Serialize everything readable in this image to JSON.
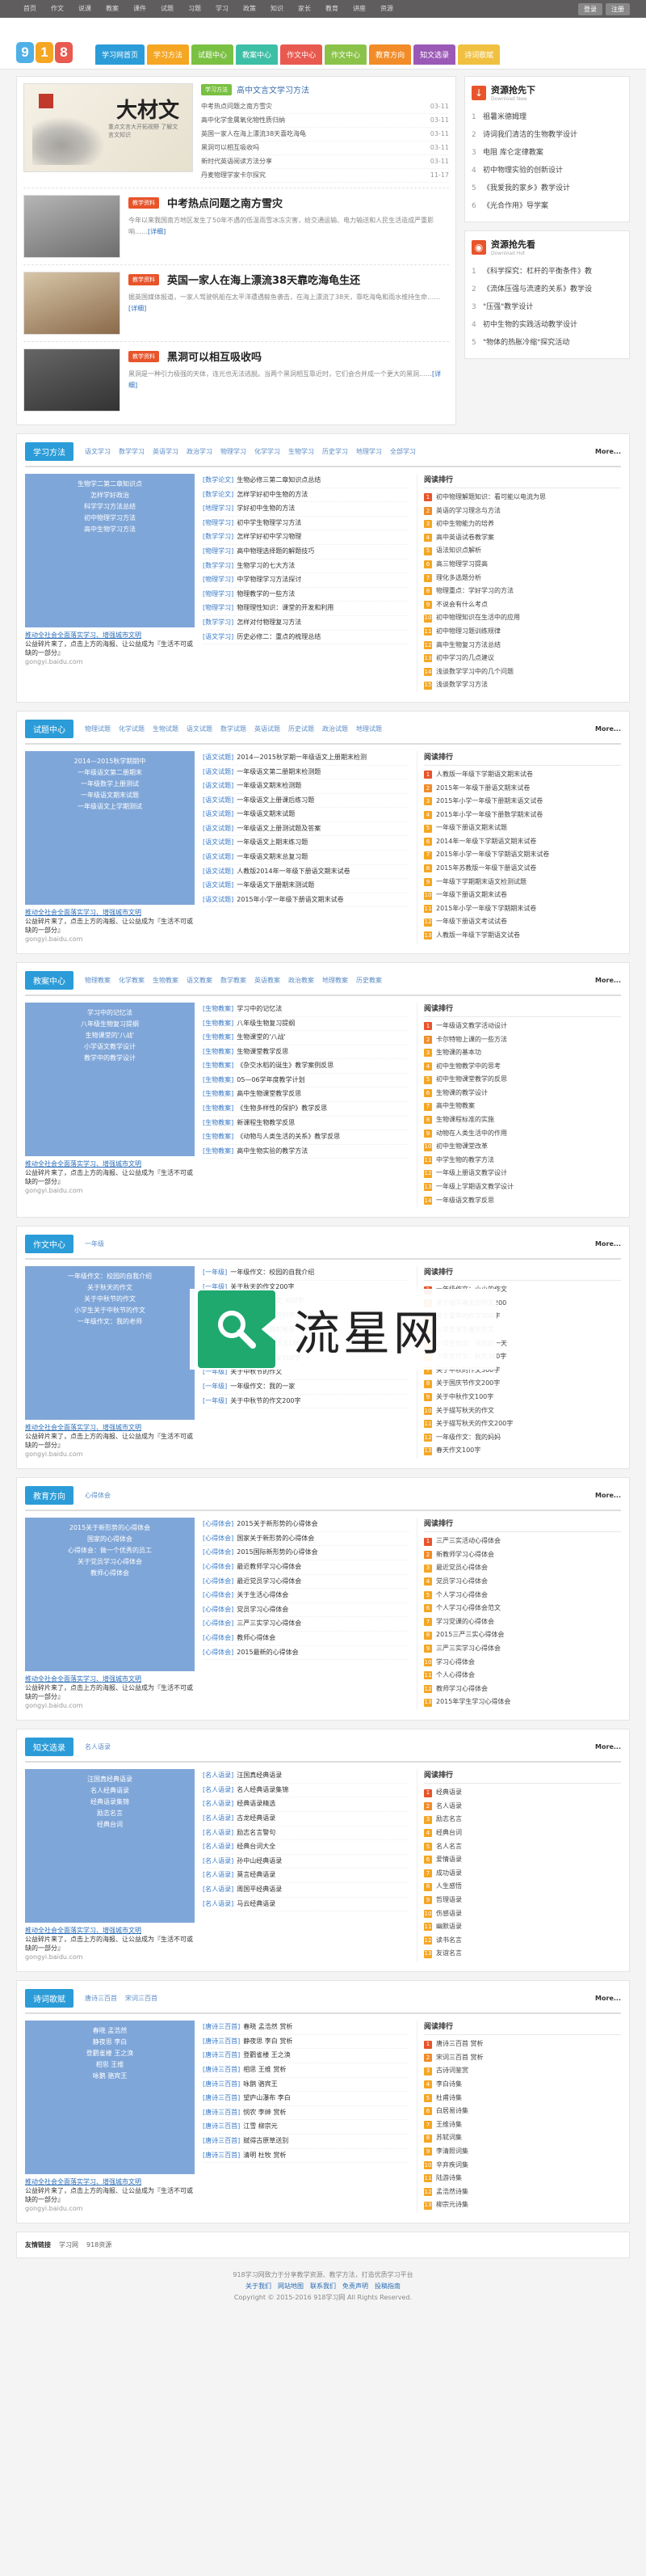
{
  "topbar": {
    "nav": [
      "首页",
      "作文",
      "说课",
      "教案",
      "课件",
      "试题",
      "习题",
      "学习",
      "政策",
      "知识",
      "家长",
      "教育",
      "讲座",
      "资源"
    ],
    "login": "登录",
    "register": "注册"
  },
  "logo": {
    "chars": [
      "9",
      "1",
      "8"
    ],
    "colors": [
      "#4fb0e8",
      "#f5a623",
      "#e85a4f"
    ]
  },
  "mainnav": [
    {
      "label": "学习网首页",
      "color": "#2b9cd8"
    },
    {
      "label": "学习方法",
      "color": "#f5a623"
    },
    {
      "label": "试题中心",
      "color": "#7ac143"
    },
    {
      "label": "教案中心",
      "color": "#3dbfa6"
    },
    {
      "label": "作文中心",
      "color": "#e85a4f"
    },
    {
      "label": "作文中心",
      "color": "#8bc34a"
    },
    {
      "label": "教育方向",
      "color": "#f28c28"
    },
    {
      "label": "知文选录",
      "color": "#9b59b6"
    },
    {
      "label": "诗词歌赋",
      "color": "#f0c040"
    }
  ],
  "hero": {
    "tag": "学习方法",
    "title": "高中文言文学习方法",
    "image_title": "大材文",
    "image_sub": "重点文言大开拓视野 了解文言文知识",
    "rows": [
      {
        "t": "中考热点问题之南方雪灾",
        "d": "03-11"
      },
      {
        "t": "高中化学金属氧化物性质归纳",
        "d": "03-11"
      },
      {
        "t": "英国一家人在海上漂流38天喜吃海龟",
        "d": "03-11"
      },
      {
        "t": "黑洞可以相互吸收吗",
        "d": "03-11"
      },
      {
        "t": "新时代英语阅读方法分享",
        "d": "03-11"
      },
      {
        "t": "丹麦物理学家卡尔探究",
        "d": "11-17"
      }
    ]
  },
  "news": [
    {
      "tag": "教学资料",
      "title": "中考热点问题之南方雪灾",
      "desc": "今年以来我国南方地区发生了50年不遇的低温雨雪冰冻灾害，给交通运输、电力输送和人民生活造成严重影响……",
      "more": "[详细]"
    },
    {
      "tag": "教学资料",
      "title": "英国一家人在海上漂流38天靠吃海龟生还",
      "desc": "据英国媒体报道，一家人驾驶帆船在太平洋遭遇鲸鱼袭击，在海上漂流了38天，靠吃海龟和雨水维持生命……",
      "more": "[详细]"
    },
    {
      "tag": "教学资料",
      "title": "黑洞可以相互吸收吗",
      "desc": "黑洞是一种引力极强的天体，连光也无法逃脱。当两个黑洞相互靠近时，它们会合并成一个更大的黑洞……",
      "more": "[详细]"
    }
  ],
  "resources_down": {
    "title": "资源抢先下",
    "subtitle": "Download New",
    "items": [
      "祖暑米德姆理",
      "诗词我们清洁的生物教学设计",
      "电阻  库仑定律教案",
      "初中物理实验的创新设计",
      "《我爱我的家乡》教学设计",
      "《光合作用》导学案"
    ]
  },
  "resources_look": {
    "title": "资源抢先看",
    "subtitle": "Download Hot",
    "items": [
      "《科学探究：杠杆的平衡条件》教",
      "《流体压强与流速的关系》教学设",
      "\"压强\"教学设计",
      "初中生物的实践活动教学设计",
      "\"物体的热胀冷缩\"探究活动"
    ]
  },
  "ad": {
    "title_line": "推动全社会全面落实学习、增强城市文明",
    "desc": "公益碎片来了，点击上方的海报、让公益成为『生活不可或缺的一部分』",
    "url": "gongyi.baidu.com"
  },
  "sections": [
    {
      "title": "学习方法",
      "color": "#2b9cd8",
      "tabs": [
        "语文学习",
        "数学学习",
        "英语学习",
        "政治学习",
        "物理学习",
        "化学学习",
        "生物学习",
        "历史学习",
        "地理学习",
        "全部学习"
      ],
      "more": "More...",
      "ad_lines": [
        "生物学二第二章知识点",
        "怎样学好政治",
        "科学学习方法总结",
        "初中物理学习方法",
        "高中生物学习方法"
      ],
      "mid": [
        {
          "c": "[数学论文]",
          "t": "生物必修三第二章知识点总结"
        },
        {
          "c": "[数学论文]",
          "t": "怎样学好初中生物的方法"
        },
        {
          "c": "[地理学习]",
          "t": "学好初中生物的方法"
        },
        {
          "c": "[物理学习]",
          "t": "初中学生物理学习方法"
        },
        {
          "c": "[数学学习]",
          "t": "怎样学好初中学习物理"
        },
        {
          "c": "[物理学习]",
          "t": "高中物理选择题的解题技巧"
        },
        {
          "c": "[数学学习]",
          "t": "生物学习的七大方法"
        },
        {
          "c": "[物理学习]",
          "t": "中学物理学习方法探讨"
        },
        {
          "c": "[物理学习]",
          "t": "物理教学的一些方法"
        },
        {
          "c": "[物理学习]",
          "t": "物理理性知识：课堂的开发和利用"
        },
        {
          "c": "[数学学习]",
          "t": "怎样对付物理复习方法"
        },
        {
          "c": "[语文学习]",
          "t": "历史必修二：重点的梳理总结"
        }
      ],
      "rank_title": "阅读排行",
      "rank": [
        "初中物理解题知识：看可能以电流为思",
        "英语的学习理念与方法",
        "初中生物能力的培养",
        "高中英语试卷教学案",
        "语法知识点解析",
        "高三物理学习提高",
        "理化多选题分析",
        "物理重点：学好学习的方法",
        "不说会有什么考点",
        "初中物理知识在生活中的应用",
        "初中物理习题训练规律",
        "高中生物复习方法总结",
        "初中学习的几点建议",
        "浅谈数学学习中的几个问题",
        "浅谈数学学习方法"
      ]
    },
    {
      "title": "试题中心",
      "color": "#2b9cd8",
      "tabs": [
        "物理试题",
        "化学试题",
        "生物试题",
        "语文试题",
        "数学试题",
        "英语试题",
        "历史试题",
        "政治试题",
        "地理试题"
      ],
      "more": "More...",
      "ad_lines": [
        "2014—2015秋学期期中",
        "一年级语文第二册期末",
        "一年级数学上册测试",
        "一年级语文期末试题",
        "一年级语文上学期测试"
      ],
      "mid": [
        {
          "c": "[语文试题]",
          "t": "2014—2015秋学期一年级语文上册期末检测"
        },
        {
          "c": "[语文试题]",
          "t": "一年级语文第二册期末检测题"
        },
        {
          "c": "[语文试题]",
          "t": "一年级语文期末检测题"
        },
        {
          "c": "[语文试题]",
          "t": "一年级语文上册课后练习题"
        },
        {
          "c": "[语文试题]",
          "t": "一年级语文期末试题"
        },
        {
          "c": "[语文试题]",
          "t": "一年级语文上册测试题及答案"
        },
        {
          "c": "[语文试题]",
          "t": "一年级语文上期末练习题"
        },
        {
          "c": "[语文试题]",
          "t": "一年级语文期末总复习题"
        },
        {
          "c": "[语文试题]",
          "t": "人教版2014年一年级下册语文期末试卷"
        },
        {
          "c": "[语文试题]",
          "t": "一年级语文下册期末测试题"
        },
        {
          "c": "[语文试题]",
          "t": "2015年小学一年级下册语文期末试卷"
        }
      ],
      "rank_title": "阅读排行",
      "rank": [
        "人教版一年级下学期语文期末试卷",
        "2015年一年级下册语文期末试卷",
        "2015年小学一年级下册期末语文试卷",
        "2015年小学一年级下册数学期末试卷",
        "一年级下册语文期末试题",
        "2014年一年级下学期语文期末试卷",
        "2015年小学一年级下学期语文期末试卷",
        "2015年苏教版一年级下册语文试卷",
        "一年级下学期期末语文检测试题",
        "一年级下册语文期末试卷",
        "2015年小学一年级下学期期末试卷",
        "一年级下册语文考试试卷",
        "人教版一年级下学期语文试卷"
      ]
    },
    {
      "title": "教案中心",
      "color": "#2b9cd8",
      "tabs": [
        "物理教案",
        "化学教案",
        "生物教案",
        "语文教案",
        "数学教案",
        "英语教案",
        "政治教案",
        "地理教案",
        "历史教案"
      ],
      "more": "More...",
      "ad_lines": [
        "学习中的记忆法",
        "八年级生物复习提纲",
        "生物课堂的'八战'",
        "小学语文教学设计",
        "教学中的教学设计"
      ],
      "mid": [
        {
          "c": "[生物教案]",
          "t": "学习中的记忆法"
        },
        {
          "c": "[生物教案]",
          "t": "八年级生物复习提纲"
        },
        {
          "c": "[生物教案]",
          "t": "生物课堂的'八战'"
        },
        {
          "c": "[生物教案]",
          "t": "生物课堂教学反思"
        },
        {
          "c": "[生物教案]",
          "t": "《杂交水稻的诞生》教学案例反思"
        },
        {
          "c": "[生物教案]",
          "t": "05—06学年度教学计划"
        },
        {
          "c": "[生物教案]",
          "t": "高中生物课堂教学反思"
        },
        {
          "c": "[生物教案]",
          "t": "《生物多样性的保护》教学反思"
        },
        {
          "c": "[生物教案]",
          "t": "新课程生物教学反思"
        },
        {
          "c": "[生物教案]",
          "t": "《动物与人类生活的关系》教学反思"
        },
        {
          "c": "[生物教案]",
          "t": "高中生物实验的教学方法"
        }
      ],
      "rank_title": "阅读排行",
      "rank": [
        "一年级语文教学活动设计",
        "卡尔特物上课的一些方法",
        "生物课的基本功",
        "初中生物教学中的思考",
        "初中生物课堂教学的反思",
        "生物课的教学设计",
        "高中生物教案",
        "生物课程标准的实施",
        "动物在人类生活中的作用",
        "初中生物课堂改革",
        "中学生物的教学方法",
        "一年级上册语文教学设计",
        "一年级上学期语文教学设计",
        "一年级语文教学反思"
      ]
    },
    {
      "title": "作文中心",
      "color": "#2b9cd8",
      "tabs": [
        "一年级"
      ],
      "more": "More...",
      "ad_lines": [
        "一年级作文：校园的自我介绍",
        "关于秋天的作文",
        "关于中秋节的作文",
        "小学生关于中秋节的作文",
        "一年级作文：我的老师"
      ],
      "mid": [
        {
          "c": "[一年级]",
          "t": "一年级作文：校园的自我介绍"
        },
        {
          "c": "[一年级]",
          "t": "关于秋天的作文200字"
        },
        {
          "c": "[一年级]",
          "t": "关于中秋节的作文_400字"
        },
        {
          "c": "[一年级]",
          "t": "小学生关于中秋节的作文"
        },
        {
          "c": "[一年级]",
          "t": "一年级作文：我的老师"
        },
        {
          "c": "[一年级]",
          "t": "小学生写秋天的作文100"
        },
        {
          "c": "[一年级]",
          "t": "小学生国庆的作文100字"
        },
        {
          "c": "[一年级]",
          "t": "关于中秋节的作文"
        },
        {
          "c": "[一年级]",
          "t": "一年级作文：我的一家"
        },
        {
          "c": "[一年级]",
          "t": "关于中秋节的作文200字"
        }
      ],
      "rank_title": "阅读排行",
      "rank": [
        "一年级作文：小小的作文",
        "关于描写春天的作文200",
        "关于童年的作文300字",
        "小学生关于春天作文",
        "小学生作文：快乐的一天",
        "小学生作文：秋天300字",
        "关于中秋的作文300字",
        "关于国庆节作文200字",
        "关于中秋作文100字",
        "关于描写秋天的作文",
        "关于描写秋天的作文200字",
        "一年级作文：我的妈妈",
        "春天作文100字"
      ]
    },
    {
      "title": "教育方向",
      "color": "#2b9cd8",
      "tabs": [
        "心得体会"
      ],
      "more": "More...",
      "ad_lines": [
        "2015关于新形势的心得体会",
        "国家的心得体会",
        "心得体会：做一个优秀的员工",
        "关于党员学习心得体会",
        "教师心得体会"
      ],
      "mid": [
        {
          "c": "[心得体会]",
          "t": "2015关于新形势的心得体会"
        },
        {
          "c": "[心得体会]",
          "t": "国家关于新形势的心得体会"
        },
        {
          "c": "[心得体会]",
          "t": "2015国际新形势的心得体会"
        },
        {
          "c": "[心得体会]",
          "t": "最近教师学习心得体会"
        },
        {
          "c": "[心得体会]",
          "t": "最近党员学习心得体会"
        },
        {
          "c": "[心得体会]",
          "t": "关于生活心得体会"
        },
        {
          "c": "[心得体会]",
          "t": "党员学习心得体会"
        },
        {
          "c": "[心得体会]",
          "t": "三严三实学习心得体会"
        },
        {
          "c": "[心得体会]",
          "t": "教师心得体会"
        },
        {
          "c": "[心得体会]",
          "t": "2015最新的心得体会"
        }
      ],
      "rank_title": "阅读排行",
      "rank": [
        "三严三实活动心得体会",
        "新教师学习心得体会",
        "最近党员心得体会",
        "党员学习心得体会",
        "个人学习心得体会",
        "个人学习心得体会范文",
        "学习党课的心得体会",
        "2015三严三实心得体会",
        "三严三实学习心得体会",
        "学习心得体会",
        "个人心得体会",
        "教师学习心得体会",
        "2015年学生学习心得体会"
      ]
    },
    {
      "title": "知文选录",
      "color": "#2b9cd8",
      "tabs": [
        "名人语录"
      ],
      "more": "More...",
      "ad_lines": [
        "汪国真经典语录",
        "名人经典语录",
        "经典语录集锦",
        "励志名言",
        "经典台词"
      ],
      "mid": [
        {
          "c": "[名人语录]",
          "t": "汪国真经典语录"
        },
        {
          "c": "[名人语录]",
          "t": "名人经典语录集锦"
        },
        {
          "c": "[名人语录]",
          "t": "经典语录精选"
        },
        {
          "c": "[名人语录]",
          "t": "古龙经典语录"
        },
        {
          "c": "[名人语录]",
          "t": "励志名言警句"
        },
        {
          "c": "[名人语录]",
          "t": "经典台词大全"
        },
        {
          "c": "[名人语录]",
          "t": "孙中山经典语录"
        },
        {
          "c": "[名人语录]",
          "t": "莫言经典语录"
        },
        {
          "c": "[名人语录]",
          "t": "周国平经典语录"
        },
        {
          "c": "[名人语录]",
          "t": "马云经典语录"
        }
      ],
      "rank_title": "阅读排行",
      "rank": [
        "经典语录",
        "名人语录",
        "励志名言",
        "经典台词",
        "名人名言",
        "爱情语录",
        "成功语录",
        "人生感悟",
        "哲理语录",
        "伤感语录",
        "幽默语录",
        "读书名言",
        "友谊名言"
      ]
    },
    {
      "title": "诗词歌赋",
      "color": "#2b9cd8",
      "tabs": [
        "唐诗三百首",
        "宋词三百首"
      ],
      "more": "More...",
      "ad_lines": [
        "春晓 孟浩然",
        "静夜思 李白",
        "登鹳雀楼 王之涣",
        "相思 王维",
        "咏鹅 骆宾王"
      ],
      "mid": [
        {
          "c": "[唐诗三百首]",
          "t": "春晓 孟浩然 赏析"
        },
        {
          "c": "[唐诗三百首]",
          "t": "静夜思 李白 赏析"
        },
        {
          "c": "[唐诗三百首]",
          "t": "登鹳雀楼 王之涣"
        },
        {
          "c": "[唐诗三百首]",
          "t": "相思 王维 赏析"
        },
        {
          "c": "[唐诗三百首]",
          "t": "咏鹅 骆宾王"
        },
        {
          "c": "[唐诗三百首]",
          "t": "望庐山瀑布 李白"
        },
        {
          "c": "[唐诗三百首]",
          "t": "悯农 李绅 赏析"
        },
        {
          "c": "[唐诗三百首]",
          "t": "江雪 柳宗元"
        },
        {
          "c": "[唐诗三百首]",
          "t": "赋得古原草送别"
        },
        {
          "c": "[唐诗三百首]",
          "t": "清明 杜牧 赏析"
        }
      ],
      "rank_title": "阅读排行",
      "rank": [
        "唐诗三百首 赏析",
        "宋词三百首 赏析",
        "古诗词鉴赏",
        "李白诗集",
        "杜甫诗集",
        "白居易诗集",
        "王维诗集",
        "苏轼词集",
        "李清照词集",
        "辛弃疾词集",
        "陆游诗集",
        "孟浩然诗集",
        "柳宗元诗集"
      ]
    }
  ],
  "links": {
    "label": "友情链接",
    "items": [
      "学习网",
      "918资源"
    ]
  },
  "footer": {
    "line1": "918学习网致力于分享教学资源、教学方法，打造优质学习平台",
    "links": [
      "关于我们",
      "网站地图",
      "联系我们",
      "免责声明",
      "投稿指南"
    ],
    "copyright": "Copyright © 2015-2016 918学习网 All Rights Reserved."
  },
  "watermark": {
    "text": "流星网"
  }
}
